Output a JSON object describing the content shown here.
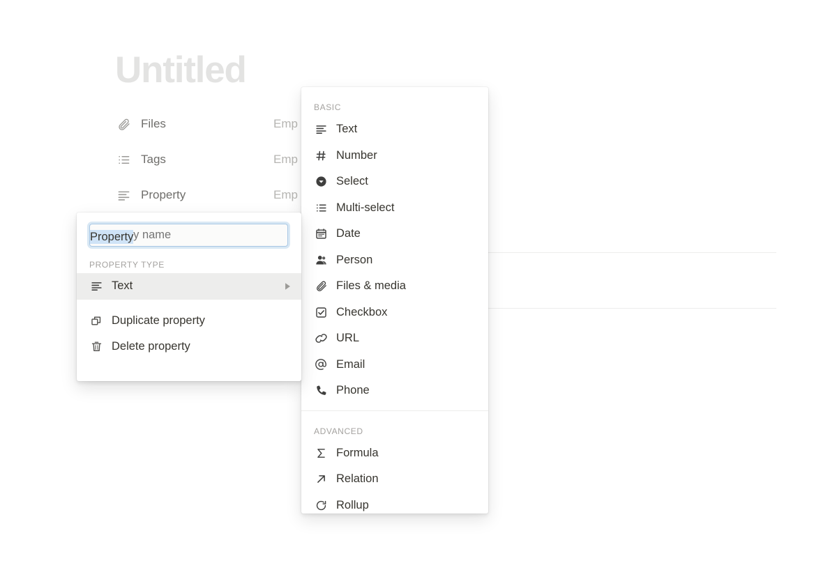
{
  "page": {
    "title": "Untitled",
    "properties": [
      {
        "icon": "paperclip-icon",
        "label": "Files",
        "value": "Emp"
      },
      {
        "icon": "list-icon",
        "label": "Tags",
        "value": "Emp"
      },
      {
        "icon": "text-lines-icon",
        "label": "Property",
        "value": "Emp"
      }
    ]
  },
  "property_editor": {
    "name_input": {
      "value": "Property",
      "placeholder": "Property name"
    },
    "section_label": "PROPERTY TYPE",
    "current_type": {
      "icon": "text-lines-icon",
      "label": "Text",
      "caret": "triangle-right-icon"
    },
    "actions": [
      {
        "icon": "duplicate-icon",
        "label": "Duplicate property"
      },
      {
        "icon": "trash-icon",
        "label": "Delete property"
      }
    ]
  },
  "type_menu": {
    "sections": [
      {
        "label": "BASIC",
        "items": [
          {
            "icon": "text-lines-icon",
            "label": "Text"
          },
          {
            "icon": "hash-icon",
            "label": "Number"
          },
          {
            "icon": "select-circle-icon",
            "label": "Select"
          },
          {
            "icon": "list-icon",
            "label": "Multi-select"
          },
          {
            "icon": "calendar-icon",
            "label": "Date"
          },
          {
            "icon": "person-icon",
            "label": "Person"
          },
          {
            "icon": "paperclip-icon",
            "label": "Files & media"
          },
          {
            "icon": "checkbox-icon",
            "label": "Checkbox"
          },
          {
            "icon": "link-icon",
            "label": "URL"
          },
          {
            "icon": "at-icon",
            "label": "Email"
          },
          {
            "icon": "phone-icon",
            "label": "Phone"
          }
        ]
      },
      {
        "label": "ADVANCED",
        "items": [
          {
            "icon": "sigma-icon",
            "label": "Formula"
          },
          {
            "icon": "arrow-up-right-icon",
            "label": "Relation"
          },
          {
            "icon": "rollup-icon",
            "label": "Rollup"
          }
        ]
      }
    ]
  },
  "colors": {
    "background": "#ffffff",
    "title": "#e3e3e2",
    "text": "#37352f",
    "muted": "#9b9a97",
    "section_label": "#a4a29f",
    "selected_row": "#ededec",
    "input_border": "#a8c7e4",
    "text_selection": "#cfe3f7",
    "divider": "#ededec"
  }
}
